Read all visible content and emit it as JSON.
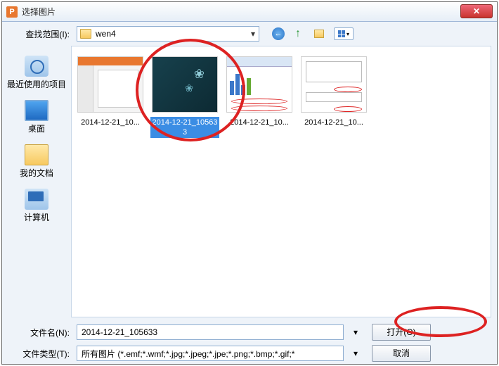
{
  "title": "选择图片",
  "look_in_label": "查找范围(I):",
  "path": "wen4",
  "places": [
    {
      "label": "最近使用的项目",
      "icon": "recent"
    },
    {
      "label": "桌面",
      "icon": "desktop"
    },
    {
      "label": "我的文档",
      "icon": "documents"
    },
    {
      "label": "计算机",
      "icon": "computer"
    }
  ],
  "files": [
    {
      "name": "2014-12-21_10...",
      "selected": false,
      "preview": "ppt"
    },
    {
      "name": "2014-12-21_105633",
      "selected": true,
      "preview": "dark"
    },
    {
      "name": "2014-12-21_10...",
      "selected": false,
      "preview": "chart"
    },
    {
      "name": "2014-12-21_10...",
      "selected": false,
      "preview": "form"
    }
  ],
  "filename_label": "文件名(N):",
  "filename_value": "2014-12-21_105633",
  "filetype_label": "文件类型(T):",
  "filetype_value": "所有图片 (*.emf;*.wmf;*.jpg;*.jpeg;*.jpe;*.png;*.bmp;*.gif;*",
  "open_btn": "打开(O)",
  "cancel_btn": "取消"
}
